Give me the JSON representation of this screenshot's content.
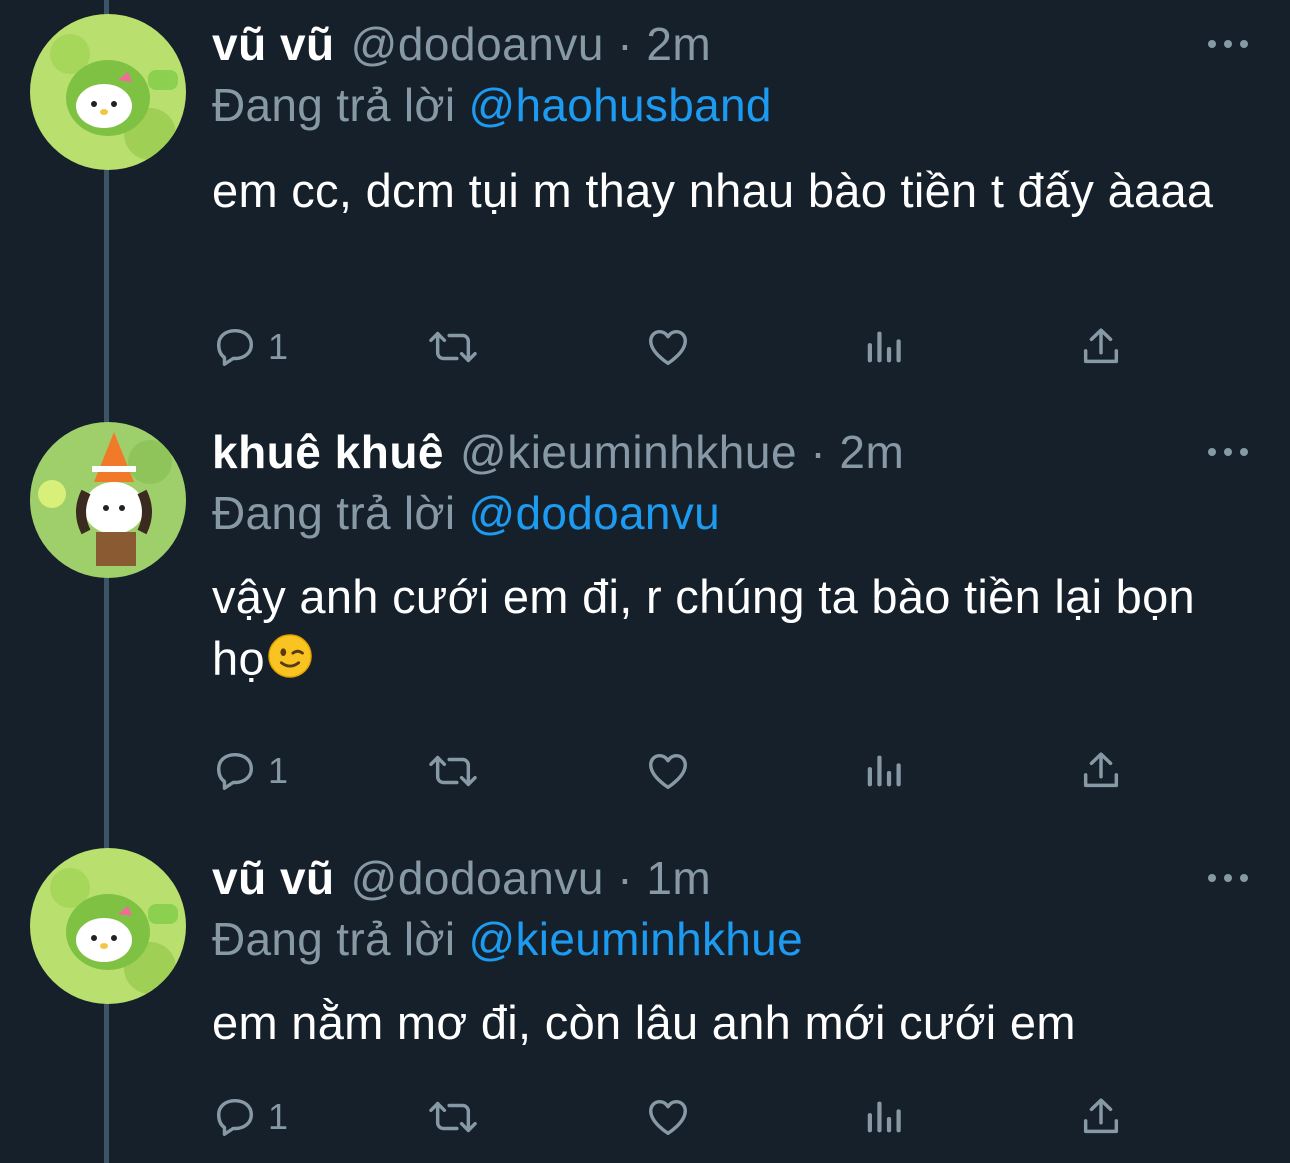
{
  "tweets": [
    {
      "name": "vũ vũ",
      "meta": "@dodoanvu · 2m",
      "reply_prefix": "Đang trả lời",
      "reply_to": "@haohusband",
      "text": "em cc, dcm tụi m thay nhau bào tiền t đấy àaaa",
      "reply_count": "1"
    },
    {
      "name": "khuê khuê",
      "meta": "@kieuminhkhue · 2m",
      "reply_prefix": "Đang trả lời",
      "reply_to": "@dodoanvu",
      "text": "vậy anh cưới em đi, r chúng ta bào tiền lại bọn họ",
      "emoji": "winking-face",
      "reply_count": "1"
    },
    {
      "name": "vũ vũ",
      "meta": "@dodoanvu · 1m",
      "reply_prefix": "Đang trả lời",
      "reply_to": "@kieuminhkhue",
      "text": "em nằm mơ đi, còn lâu anh mới cưới em",
      "reply_count": "1"
    }
  ],
  "colors": {
    "background": "#15202b",
    "muted": "#8899a6",
    "link": "#1d9bf0",
    "thread_line": "#3d5466"
  }
}
